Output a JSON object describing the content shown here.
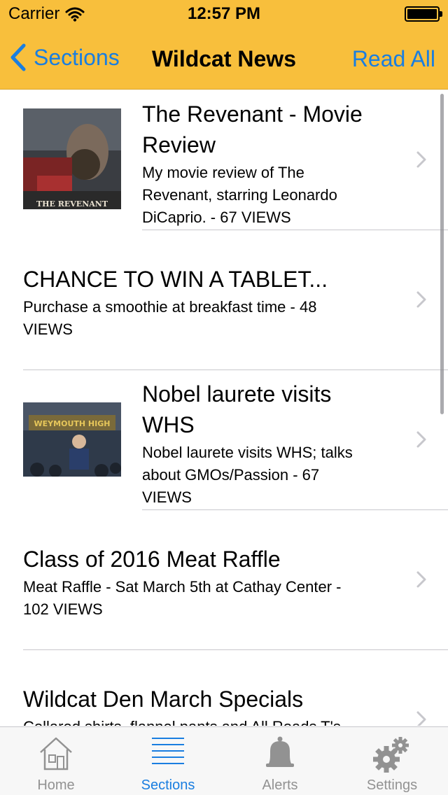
{
  "status": {
    "carrier": "Carrier",
    "time": "12:57 PM",
    "battery_level": 1.0
  },
  "nav": {
    "back_label": "Sections",
    "title": "Wildcat News",
    "action_label": "Read All"
  },
  "articles": [
    {
      "title_line1": "The Revenant - Movie",
      "title_line2": "Review",
      "desc_line1": "My movie review of The",
      "desc_line2": "Revenant, starring Leonardo",
      "desc_line3": "DiCaprio. - 67 VIEWS",
      "thumb_text": "THE REVENANT"
    },
    {
      "title_line1": "CHANCE TO WIN A TABLET...",
      "desc_line1": "Purchase a smoothie at breakfast time - 48",
      "desc_line2": "VIEWS"
    },
    {
      "title_line1": "Nobel laurete visits",
      "title_line2": "WHS",
      "desc_line1": "Nobel laurete visits WHS; talks",
      "desc_line2": "about GMOs/Passion - 67",
      "desc_line3": "VIEWS",
      "thumb_text": "WEYMOUTH HIGH"
    },
    {
      "title_line1": "Class of 2016 Meat Raffle",
      "desc_line1": "Meat Raffle - Sat March 5th at Cathay Center -",
      "desc_line2": "102 VIEWS"
    },
    {
      "title_line1": "Wildcat Den March Specials",
      "desc_line1": "Collared shirts, flannel pants and All Roads T's"
    }
  ],
  "tabs": [
    {
      "label": "Home",
      "icon": "home-icon"
    },
    {
      "label": "Sections",
      "icon": "sections-icon",
      "active": true
    },
    {
      "label": "Alerts",
      "icon": "bell-icon"
    },
    {
      "label": "Settings",
      "icon": "gear-icon"
    }
  ],
  "colors": {
    "nav_bg": "#f8bf3c",
    "accent": "#1a7ee0",
    "tab_inactive": "#929292"
  }
}
